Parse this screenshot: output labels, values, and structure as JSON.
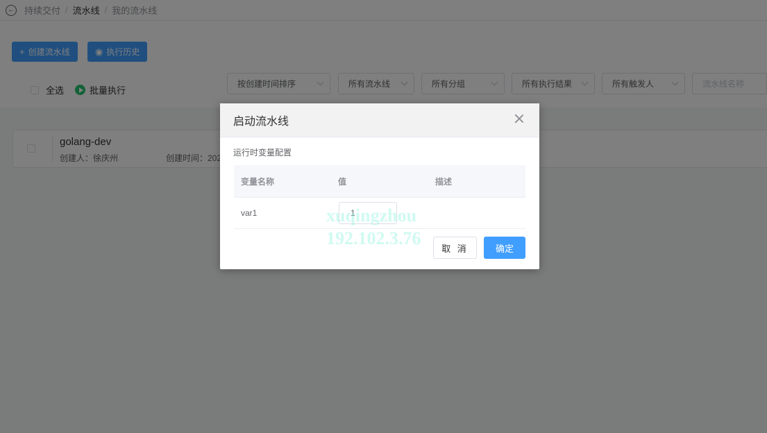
{
  "breadcrumb": {
    "items": [
      "持续交付",
      "流水线",
      "我的流水线"
    ],
    "separator": "/"
  },
  "toolbar": {
    "create_label": "创建流水线",
    "history_label": "执行历史"
  },
  "list_controls": {
    "select_all_label": "全选",
    "batch_run_label": "批量执行"
  },
  "filters": {
    "sort": "按创建时间排序",
    "pipelines": "所有流水线",
    "groups": "所有分组",
    "results": "所有执行结果",
    "triggerers": "所有触发人",
    "name_placeholder": "流水线名称"
  },
  "pipeline_card": {
    "name": "golang-dev",
    "creator": "创建人：徐庆州",
    "created_time": "创建时间：202"
  },
  "dialog": {
    "title": "启动流水线",
    "section_title": "运行时变量配置",
    "columns": [
      "变量名称",
      "值",
      "描述"
    ],
    "rows": [
      {
        "name": "var1",
        "value": "1",
        "description": ""
      }
    ],
    "cancel_label": "取 消",
    "confirm_label": "确定"
  },
  "watermark": {
    "line1": "xuqingzhou",
    "line2": "192.102.3.76"
  },
  "colors": {
    "primary": "#409eff",
    "success": "#25c26e",
    "overlay": "rgba(0,0,0,0.5)"
  }
}
